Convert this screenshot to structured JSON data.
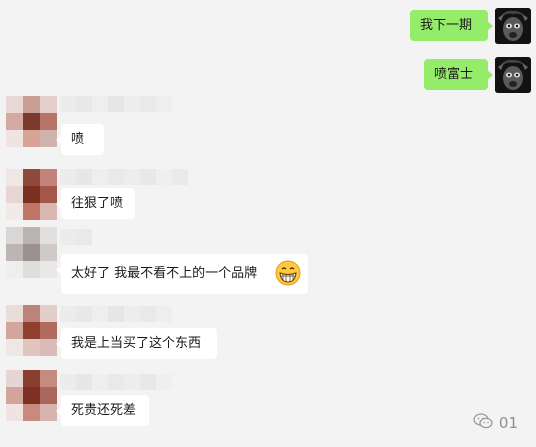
{
  "chat": {
    "messages": [
      {
        "side": "out",
        "text": "我下一期"
      },
      {
        "side": "out",
        "text": "喷富士"
      },
      {
        "side": "in",
        "text": "喷"
      },
      {
        "side": "in",
        "text": "往狠了喷"
      },
      {
        "side": "in",
        "text": "太好了 我最不看不上的一个品牌",
        "emoji": "grinning-face-icon"
      },
      {
        "side": "in",
        "text": "我是上当买了这个东西"
      },
      {
        "side": "in",
        "text": "死贵还死差"
      }
    ]
  },
  "watermark": {
    "text": "01"
  },
  "colors": {
    "outgoing_bubble": "#95ec69",
    "incoming_bubble": "#ffffff",
    "background": "#f3f3f3"
  }
}
